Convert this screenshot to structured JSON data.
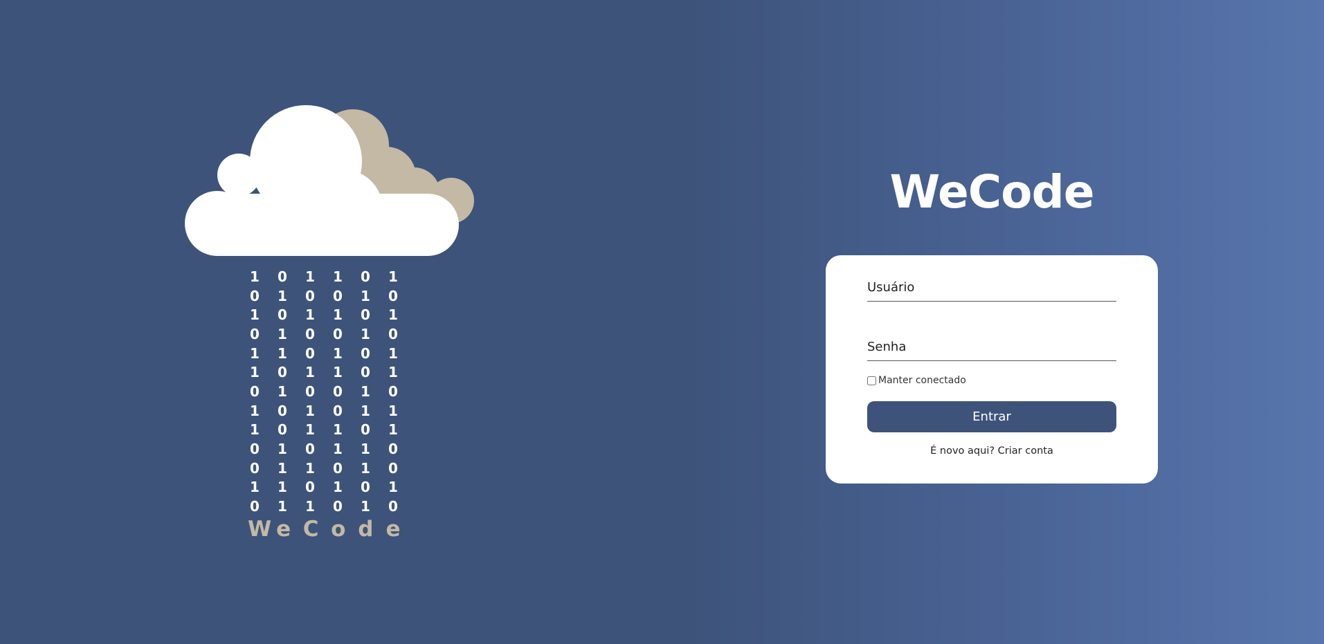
{
  "illustration": {
    "binary_rows": [
      [
        "1",
        "0",
        "1",
        "1",
        "0",
        "1"
      ],
      [
        "0",
        "1",
        "0",
        "0",
        "1",
        "0"
      ],
      [
        "1",
        "0",
        "1",
        "1",
        "0",
        "1"
      ],
      [
        "0",
        "1",
        "0",
        "0",
        "1",
        "0"
      ],
      [
        "1",
        "1",
        "0",
        "1",
        "0",
        "1"
      ],
      [
        "1",
        "0",
        "1",
        "1",
        "0",
        "1"
      ],
      [
        "0",
        "1",
        "0",
        "0",
        "1",
        "0"
      ],
      [
        "1",
        "0",
        "1",
        "0",
        "1",
        "1"
      ],
      [
        "1",
        "0",
        "1",
        "1",
        "0",
        "1"
      ],
      [
        "0",
        "1",
        "0",
        "1",
        "1",
        "0"
      ],
      [
        "0",
        "1",
        "1",
        "0",
        "1",
        "0"
      ],
      [
        "1",
        "1",
        "0",
        "1",
        "0",
        "1"
      ],
      [
        "0",
        "1",
        "1",
        "0",
        "1",
        "0"
      ]
    ],
    "brand_letters": [
      "W",
      "e",
      "C",
      "o",
      "d",
      "e"
    ],
    "colors": {
      "cloud_front": "#ffffff",
      "cloud_back": "#c3b9a5"
    }
  },
  "login": {
    "title": "WeCode",
    "username_placeholder": "Usuário",
    "password_placeholder": "Senha",
    "remember_label": "Manter conectado",
    "submit_label": "Entrar",
    "signup_prompt": "É novo aqui?",
    "signup_link": "Criar conta"
  },
  "colors": {
    "background_start": "#3d537a",
    "background_end": "#5875ad",
    "button": "#3d537a",
    "card": "#ffffff"
  }
}
